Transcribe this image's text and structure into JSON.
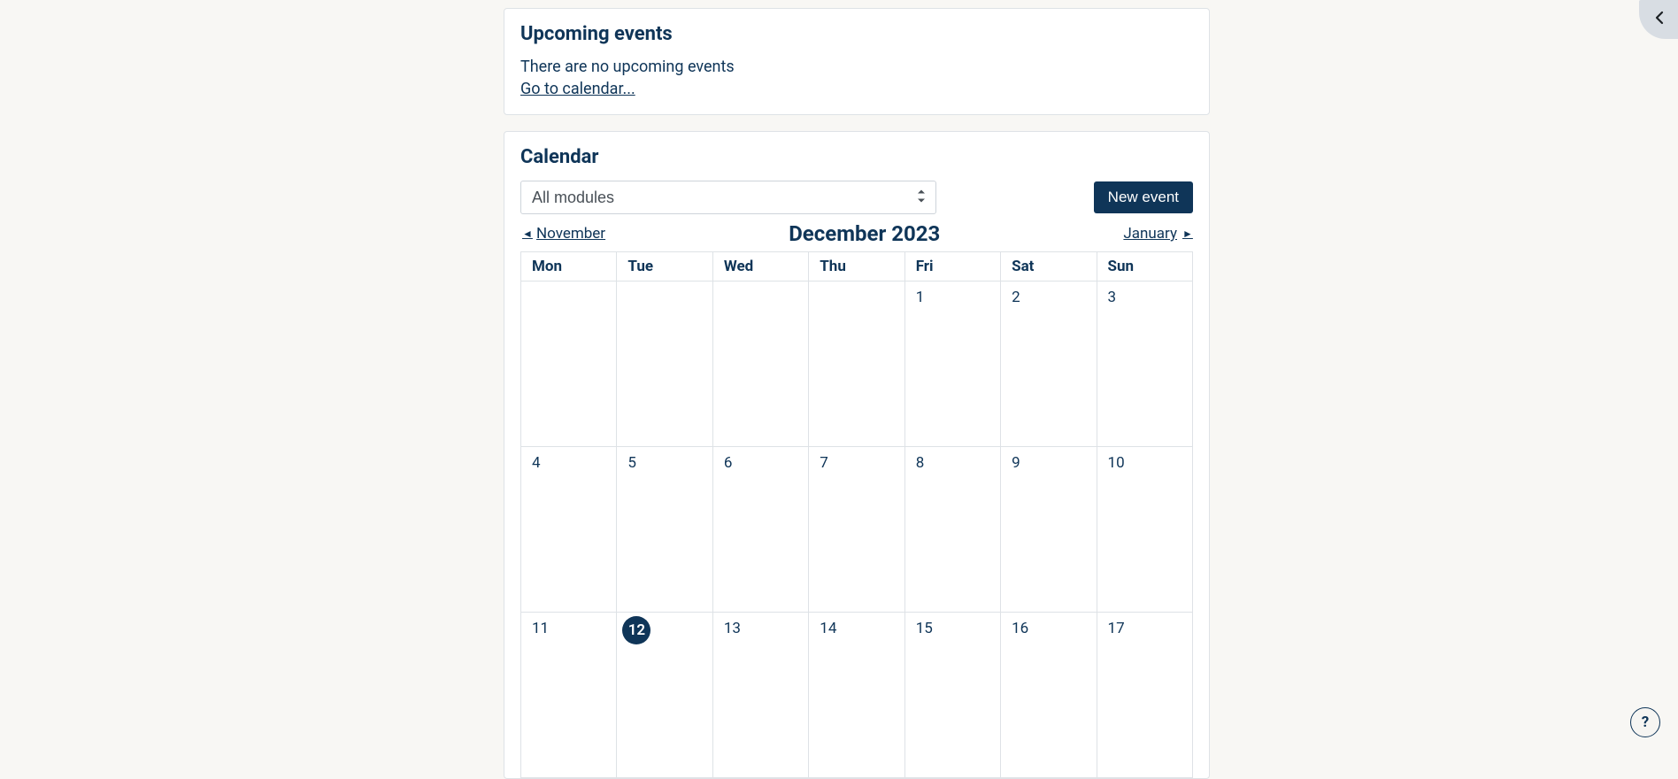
{
  "upcoming": {
    "title": "Upcoming events",
    "empty_text": "There are no upcoming events",
    "goto_link": "Go to calendar..."
  },
  "calendar": {
    "title": "Calendar",
    "filter_selected": "All modules",
    "new_event_label": "New event",
    "prev_month": "November",
    "next_month": "January",
    "current_month": "December 2023",
    "day_headers": [
      "Mon",
      "Tue",
      "Wed",
      "Thu",
      "Fri",
      "Sat",
      "Sun"
    ],
    "weeks": [
      [
        "",
        "",
        "",
        "",
        "1",
        "2",
        "3"
      ],
      [
        "4",
        "5",
        "6",
        "7",
        "8",
        "9",
        "10"
      ],
      [
        "11",
        "12",
        "13",
        "14",
        "15",
        "16",
        "17"
      ]
    ],
    "today": "12"
  },
  "help_label": "?"
}
